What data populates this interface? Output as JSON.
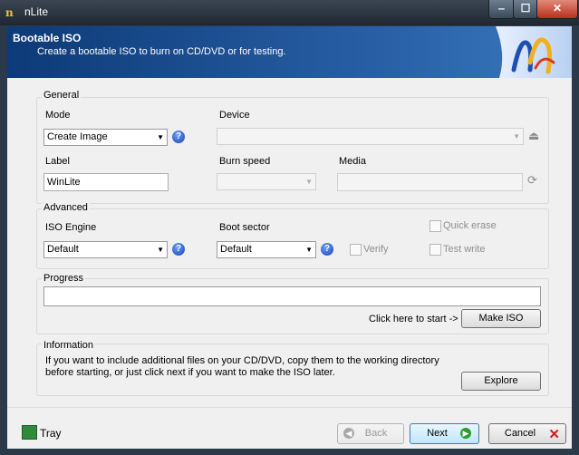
{
  "window": {
    "title": "nLite",
    "icon": "nlite-logo-icon",
    "controls": {
      "minimize": "‒",
      "maximize": "☐",
      "close": "✕"
    }
  },
  "header": {
    "title": "Bootable ISO",
    "subtitle": "Create a bootable ISO to burn on CD/DVD or for testing."
  },
  "general": {
    "group_label": "General",
    "mode_label": "Mode",
    "mode_value": "Create Image",
    "device_label": "Device",
    "device_value": "",
    "label_label": "Label",
    "label_value": "WinLite",
    "burn_speed_label": "Burn speed",
    "burn_speed_value": "",
    "media_label": "Media",
    "media_value": ""
  },
  "advanced": {
    "group_label": "Advanced",
    "iso_engine_label": "ISO Engine",
    "iso_engine_value": "Default",
    "boot_sector_label": "Boot sector",
    "boot_sector_value": "Default",
    "verify_label": "Verify",
    "quick_erase_label": "Quick erase",
    "test_write_label": "Test write"
  },
  "progress": {
    "group_label": "Progress",
    "hint": "Click here to start ->",
    "make_iso_label": "Make ISO",
    "value": 0
  },
  "information": {
    "group_label": "Information",
    "text_line1": "If you want to include additional files on your CD/DVD, copy them to the working directory",
    "text_line2": "before starting, or just click next if you want to make the ISO later.",
    "explore_label": "Explore"
  },
  "footer": {
    "tray_label": "Tray",
    "back_label": "Back",
    "next_label": "Next",
    "cancel_label": "Cancel"
  },
  "colors": {
    "header_bg": "#2a62a8",
    "accent": "#3c7fb1",
    "cancel_x": "#d11c1c",
    "next_arrow": "#2f9a2f"
  }
}
